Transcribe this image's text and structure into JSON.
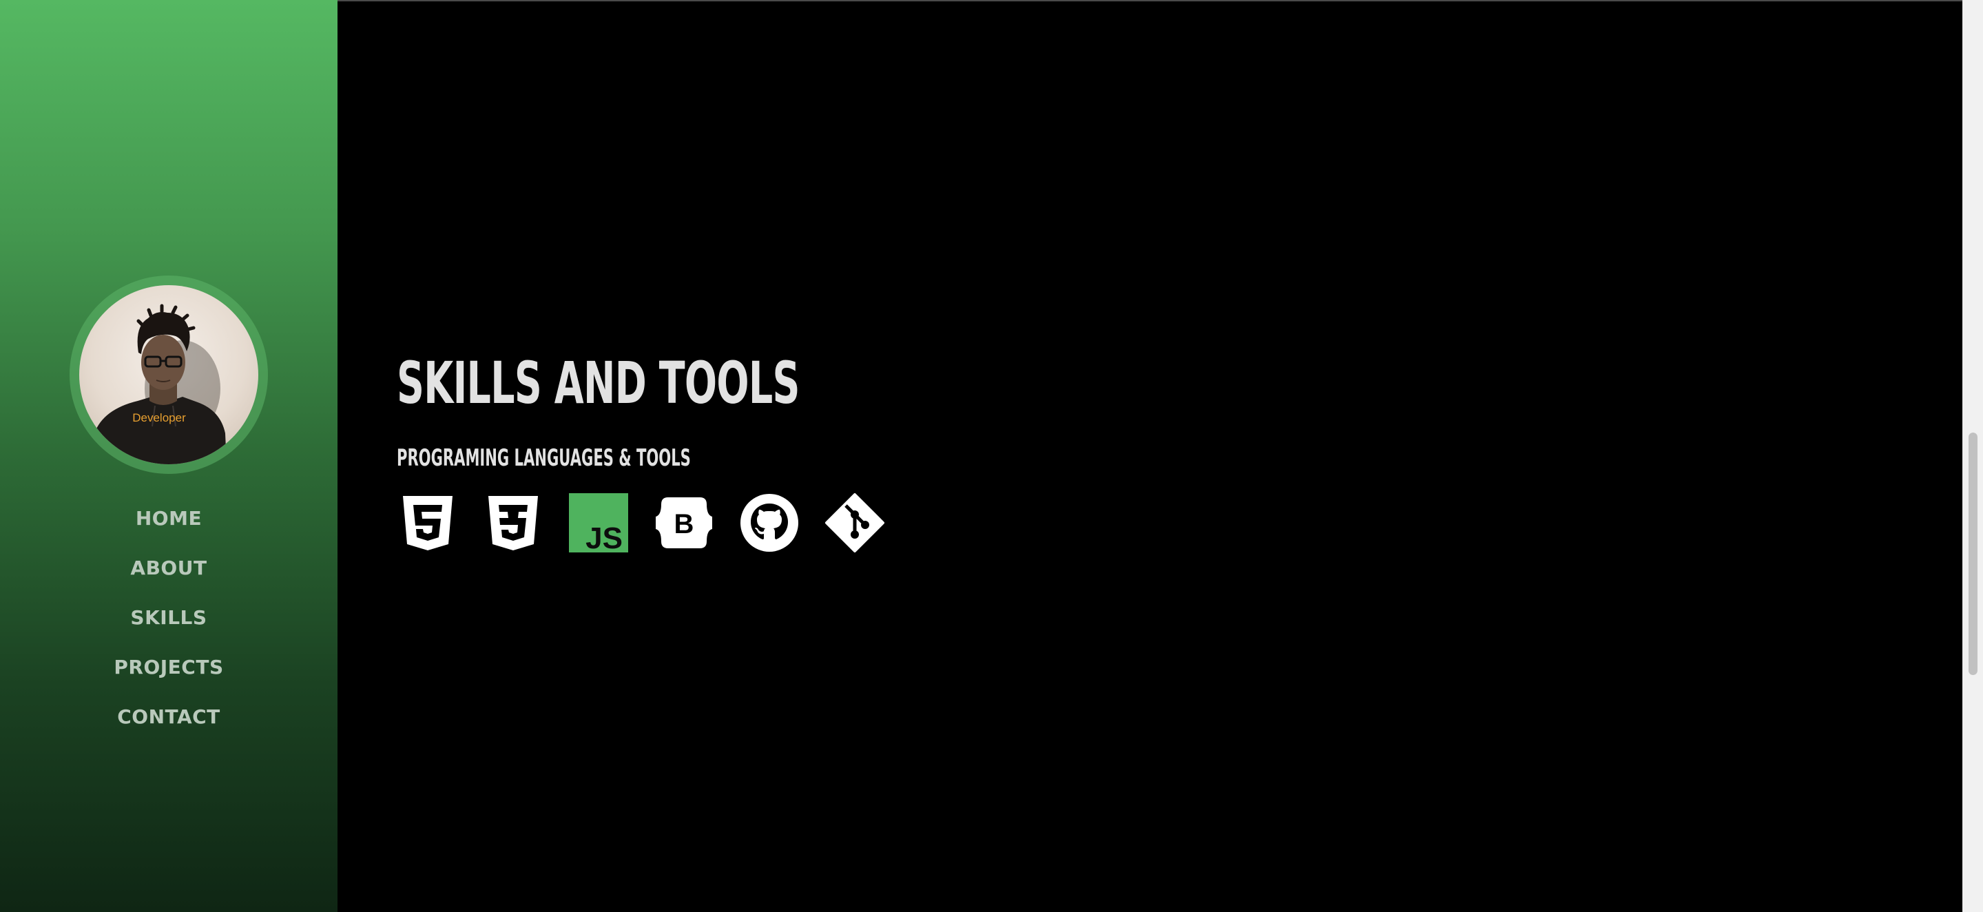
{
  "sidebar": {
    "avatar_caption": "Developer",
    "nav": [
      {
        "label": "HOME"
      },
      {
        "label": "ABOUT"
      },
      {
        "label": "SKILLS"
      },
      {
        "label": "PROJECTS"
      },
      {
        "label": "CONTACT"
      }
    ]
  },
  "main": {
    "title": "SKILLS AND TOOLS",
    "subtitle": "PROGRAMING LANGUAGES & TOOLS",
    "icons": [
      {
        "name": "html5-icon",
        "color": "#ffffff"
      },
      {
        "name": "css3-icon",
        "color": "#ffffff"
      },
      {
        "name": "javascript-icon",
        "label": "JS",
        "color": "#4fb35e"
      },
      {
        "name": "bootstrap-icon",
        "label": "B",
        "color": "#ffffff"
      },
      {
        "name": "github-icon",
        "color": "#ffffff"
      },
      {
        "name": "git-icon",
        "color": "#ffffff"
      }
    ]
  },
  "colors": {
    "sidebar_top": "#55b862",
    "sidebar_bottom": "#0f2614",
    "nav_text": "#b9c9bb",
    "accent": "#4fb35e",
    "background": "#000000"
  }
}
